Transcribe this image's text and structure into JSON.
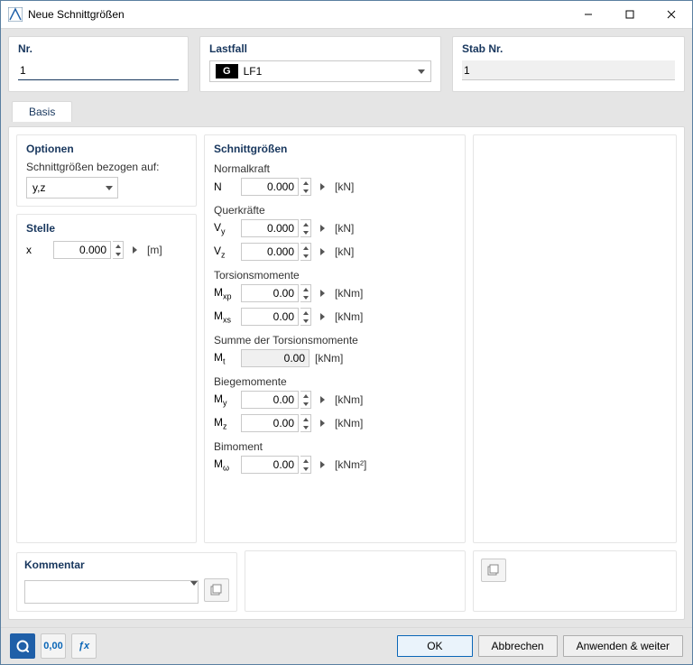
{
  "window": {
    "title": "Neue Schnittgrößen"
  },
  "winctrl": {
    "min": "–",
    "max": "☐",
    "close": "✕"
  },
  "header": {
    "nr": {
      "label": "Nr.",
      "value": "1"
    },
    "lastfall": {
      "label": "Lastfall",
      "badge": "G",
      "value": "LF1"
    },
    "stab": {
      "label": "Stab Nr.",
      "value": "1"
    }
  },
  "tabs": {
    "basis": "Basis"
  },
  "optionen": {
    "title": "Optionen",
    "label": "Schnittgrößen bezogen auf:",
    "value": "y,z"
  },
  "stelle": {
    "title": "Stelle",
    "x": {
      "label": "x",
      "value": "0.000",
      "unit": "[m]"
    }
  },
  "sg": {
    "title": "Schnittgrößen",
    "normalkraft": {
      "title": "Normalkraft",
      "N": {
        "label": "N",
        "value": "0.000",
        "unit": "[kN]"
      }
    },
    "querkraefte": {
      "title": "Querkräfte",
      "Vy": {
        "label": "V",
        "sub": "y",
        "value": "0.000",
        "unit": "[kN]"
      },
      "Vz": {
        "label": "V",
        "sub": "z",
        "value": "0.000",
        "unit": "[kN]"
      }
    },
    "torsion": {
      "title": "Torsionsmomente",
      "Mxp": {
        "label": "M",
        "sub": "xp",
        "value": "0.00",
        "unit": "[kNm]"
      },
      "Mxs": {
        "label": "M",
        "sub": "xs",
        "value": "0.00",
        "unit": "[kNm]"
      }
    },
    "torsionsum": {
      "title": "Summe der Torsionsmomente",
      "Mt": {
        "label": "M",
        "sub": "t",
        "value": "0.00",
        "unit": "[kNm]"
      }
    },
    "biege": {
      "title": "Biegemomente",
      "My": {
        "label": "M",
        "sub": "y",
        "value": "0.00",
        "unit": "[kNm]"
      },
      "Mz": {
        "label": "M",
        "sub": "z",
        "value": "0.00",
        "unit": "[kNm]"
      }
    },
    "bimoment": {
      "title": "Bimoment",
      "Mw": {
        "label": "M",
        "sub": "ω",
        "value": "0.00",
        "unit": "[kNm²]"
      }
    }
  },
  "kommentar": {
    "title": "Kommentar",
    "value": ""
  },
  "footer": {
    "tool_units": "0,00",
    "tool_fx": "ƒx",
    "ok": "OK",
    "cancel": "Abbrechen",
    "apply": "Anwenden & weiter"
  }
}
